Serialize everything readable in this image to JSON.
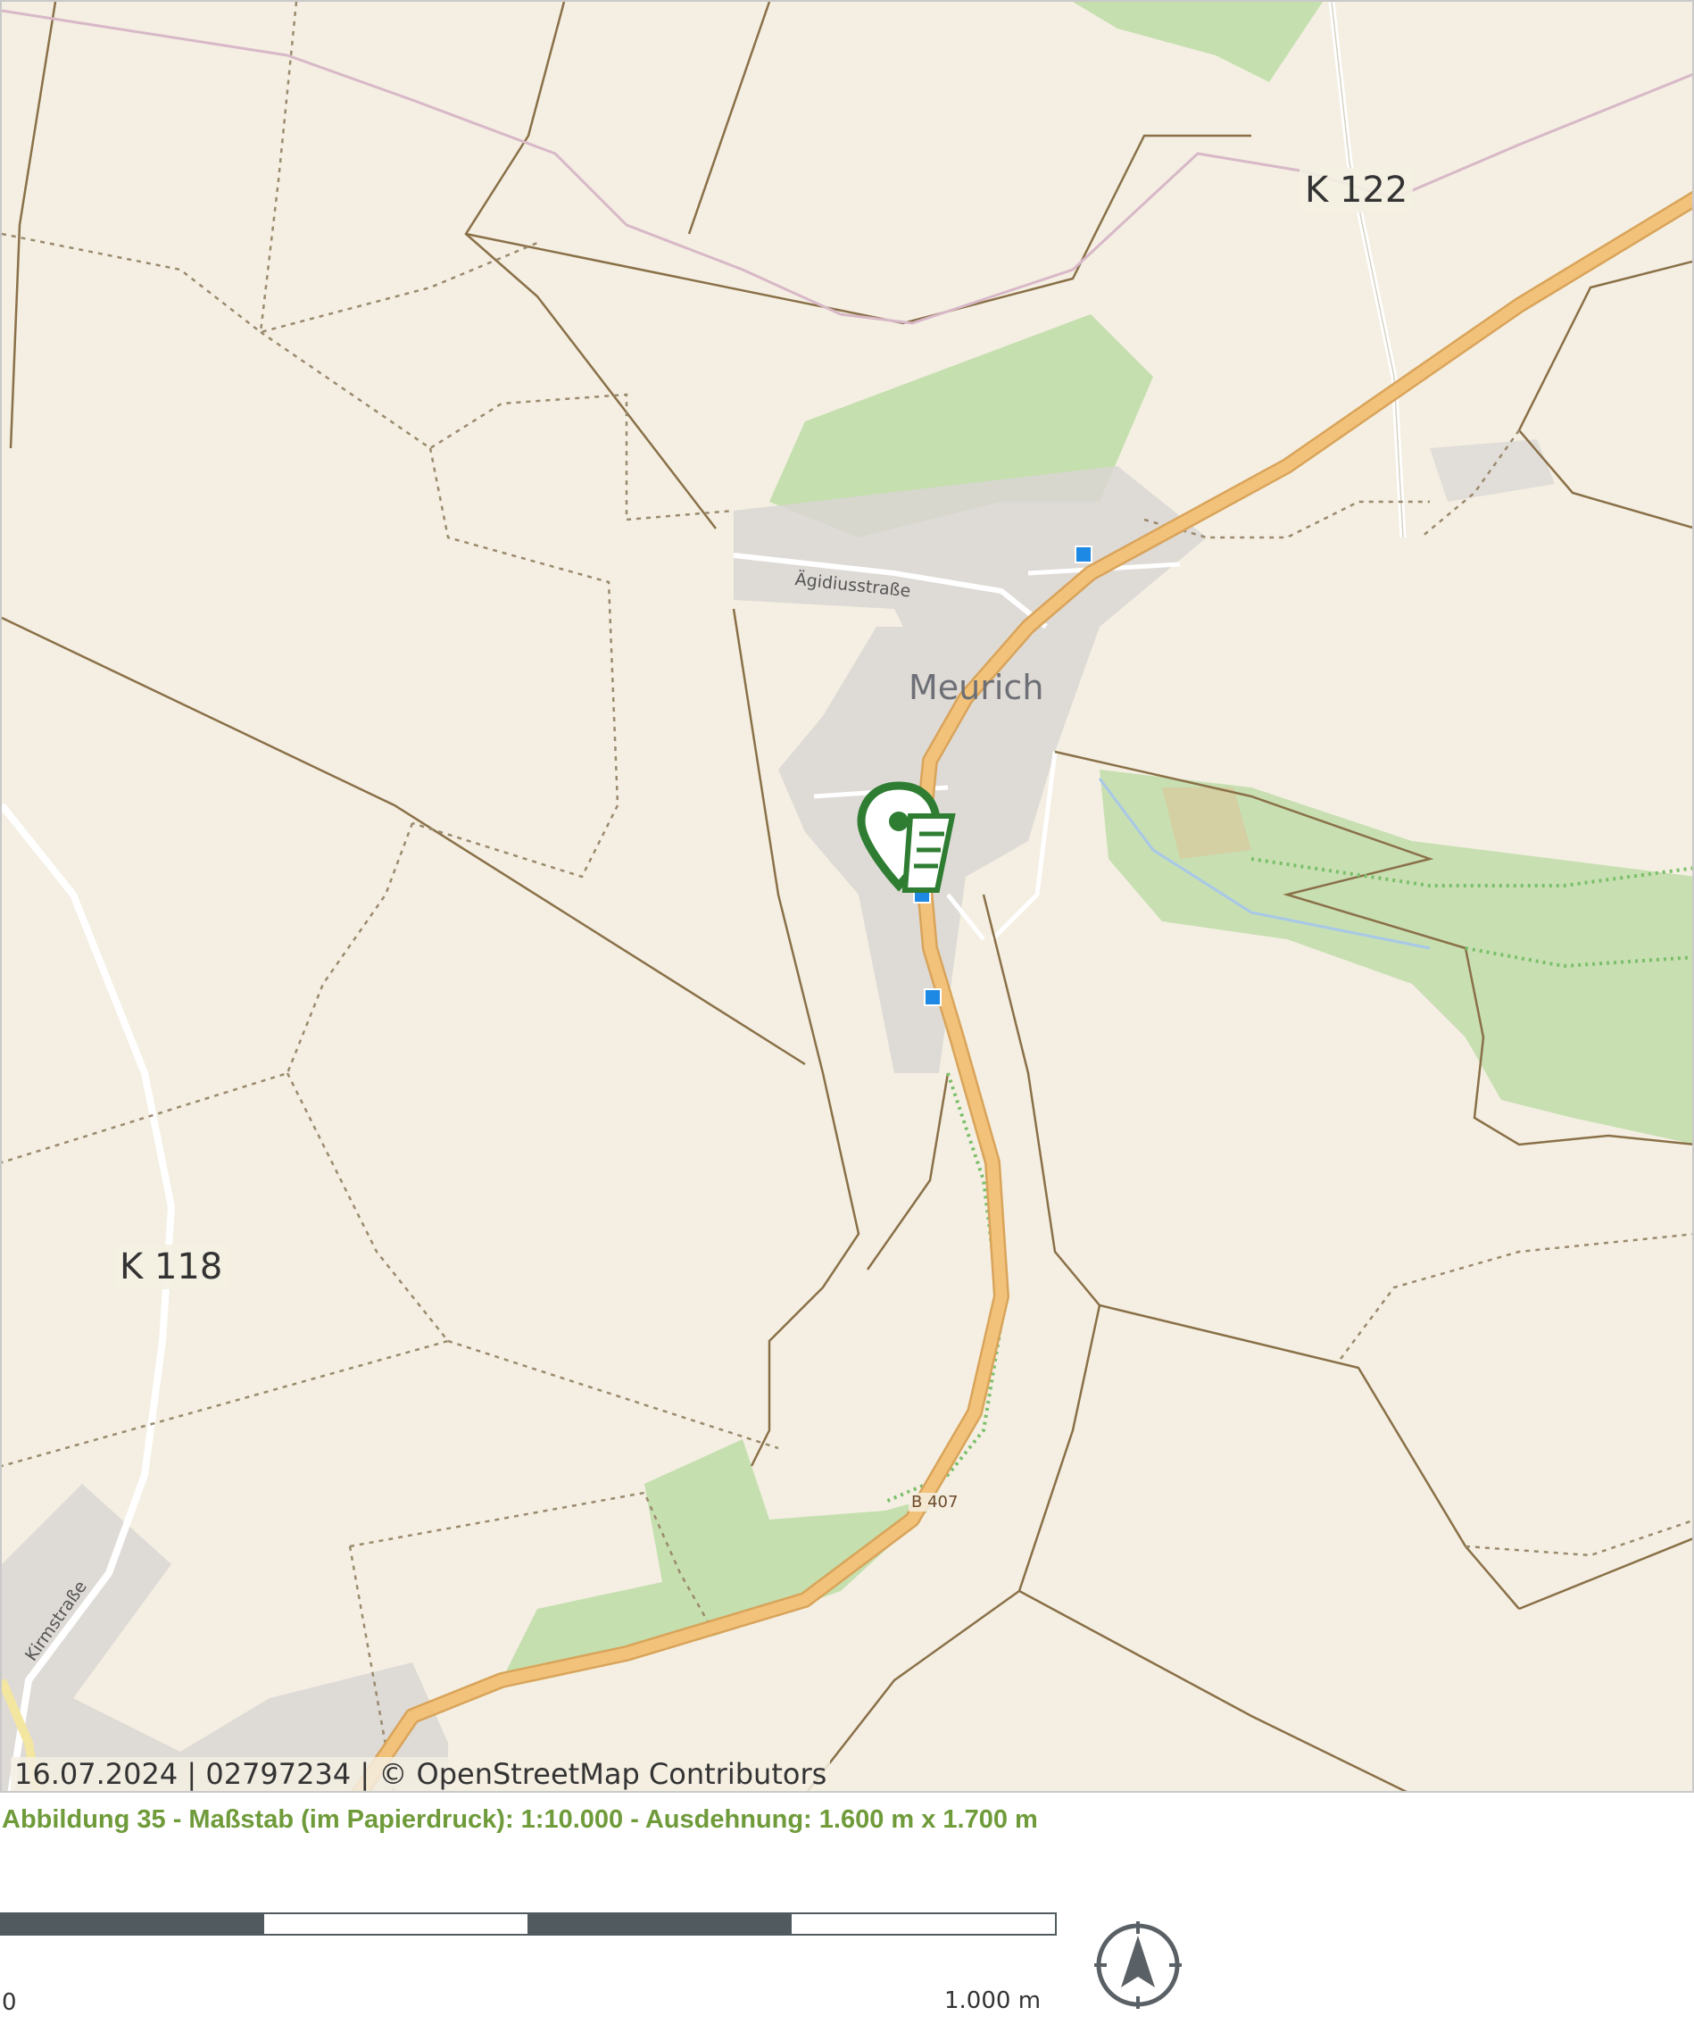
{
  "map": {
    "attribution": "16.07.2024 | 02797234 | © OpenStreetMap Contributors",
    "labels": {
      "k122": "K 122",
      "k118": "K 118",
      "meurich": "Meurich",
      "aegidiusstrasse": "Ägidiusstraße",
      "kirchstrasse": "Kirmstraße",
      "b407": "B 407"
    },
    "marker_icon": "location-pin-icon",
    "colors": {
      "land": "#f4efe2",
      "forest": "#b5d99e",
      "built_up": "#d9d6d4",
      "primary_road": "#f2c27b",
      "track": "#8a7048",
      "path": "#9a8a6e",
      "marker": "#2e7d32",
      "bus_stop": "#1e88e5"
    }
  },
  "caption": "Abbildung 35 - Maßstab (im Papierdruck): 1:10.000 - Ausdehnung: 1.600 m x 1.700 m",
  "scale_bar": {
    "start_label": "0",
    "end_label": "1.000 m",
    "segments": 4
  },
  "north_arrow": {
    "icon": "north-arrow-icon"
  }
}
